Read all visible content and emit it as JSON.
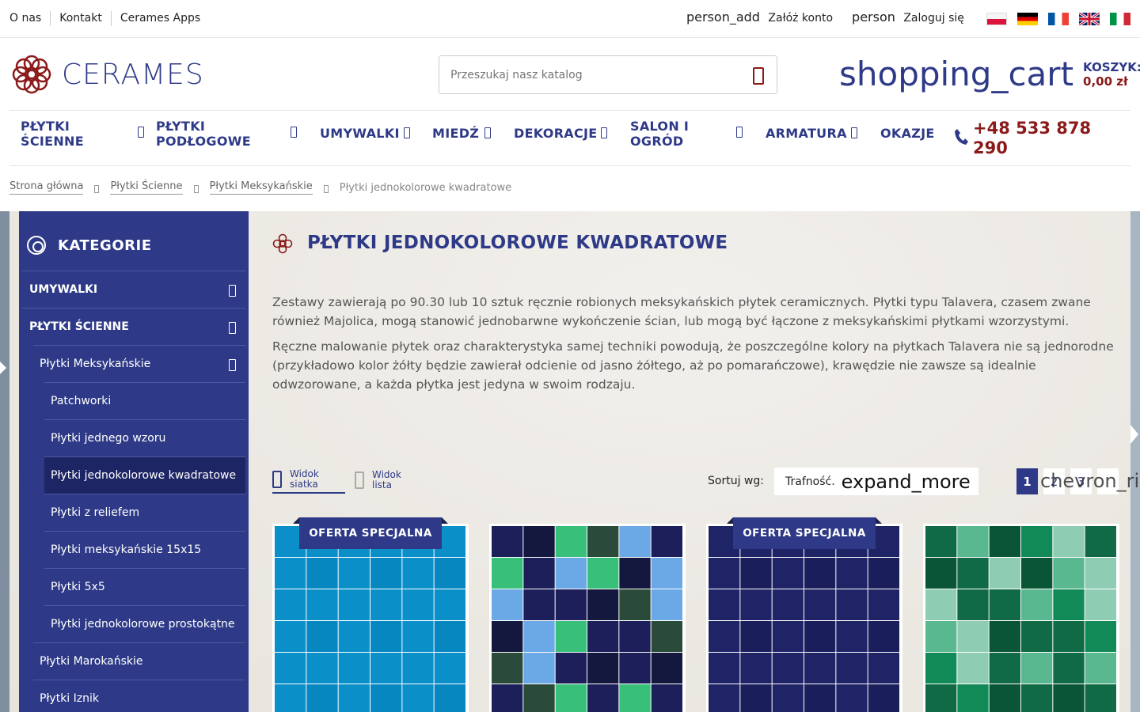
{
  "top_links": [
    "O nas",
    "Kontakt",
    "Cerames Apps"
  ],
  "account": {
    "register_icon": "person_add",
    "register_label": "Załóż konto",
    "login_icon": "person",
    "login_label": "Zaloguj się"
  },
  "languages": [
    "pl",
    "de",
    "fr",
    "en",
    "it"
  ],
  "logo_text": "CERAMES",
  "search": {
    "placeholder": "Przeszukaj nasz katalog"
  },
  "cart": {
    "icon": "shopping_cart",
    "label": "KOSZYK:",
    "total": "0,00 zł"
  },
  "nav": [
    {
      "label": "PŁYTKI ŚCIENNE",
      "dropdown": true
    },
    {
      "label": "PŁYTKI PODŁOGOWE",
      "dropdown": true
    },
    {
      "label": "UMYWALKI",
      "dropdown": true
    },
    {
      "label": "MIEDŹ",
      "dropdown": true
    },
    {
      "label": "DEKORACJE",
      "dropdown": true
    },
    {
      "label": "SALON I OGRÓD",
      "dropdown": true
    },
    {
      "label": "ARMATURA",
      "dropdown": true
    },
    {
      "label": "OKAZJE",
      "dropdown": false
    }
  ],
  "phone": "+48 533 878 290",
  "breadcrumb": [
    "Strona główna",
    "Płytki Ścienne",
    "Płytki Meksykańskie"
  ],
  "breadcrumb_current": "Płytki jednokolorowe kwadratowe",
  "sidebar": {
    "title": "KATEGORIE",
    "items": [
      {
        "label": "UMYWALKI",
        "level": 0,
        "expandable": true
      },
      {
        "label": "PŁYTKI ŚCIENNE",
        "level": 0,
        "expandable": true
      },
      {
        "label": "Płytki Meksykańskie",
        "level": 1,
        "expandable": true
      },
      {
        "label": "Patchworki",
        "level": 2
      },
      {
        "label": "Płytki jednego wzoru",
        "level": 2
      },
      {
        "label": "Płytki jednokolorowe kwadratowe",
        "level": 2,
        "active": true
      },
      {
        "label": "Płytki z reliefem",
        "level": 2
      },
      {
        "label": "Płytki meksykańskie 15x15",
        "level": 2
      },
      {
        "label": "Płytki 5x5",
        "level": 2
      },
      {
        "label": "Płytki jednokolorowe prostokątne",
        "level": 2
      },
      {
        "label": "Płytki Marokańskie",
        "level": 1
      },
      {
        "label": "Płytki Iznik",
        "level": 1
      }
    ]
  },
  "category": {
    "title": "PŁYTKI JEDNOKOLOROWE KWADRATOWE",
    "description": [
      "Zestawy zawierają po 90.30 lub 10 sztuk ręcznie robionych meksykańskich płytek ceramicznych. Płytki typu Talavera, czasem zwane również Majolica, mogą stanowić jednobarwne wykończenie ścian, lub mogą być łączone z meksykańskimi płytkami wzorzystymi.",
      "Ręczne malowanie płytek oraz charakterystyka samej techniki powodują, że poszczególne kolory na płytkach Talavera nie są jednorodne (przykładowo kolor żółty będzie zawierał odcienie od jasno żółtego, aż po pomarańczowe), krawędzie nie zawsze są idealnie odwzorowane, a każda płytka jest jedyna w swoim rodzaju."
    ]
  },
  "views": {
    "grid": "Widok siatka",
    "list": "Widok lista"
  },
  "sort": {
    "label": "Sortuj wg:",
    "value": "Trafność.",
    "icon": "expand_more"
  },
  "pagination": {
    "pages": [
      "1",
      "2",
      "3"
    ],
    "active": "1",
    "next_icon": "chevron_right"
  },
  "products": [
    {
      "badge": "OFERTA SPECJALNA",
      "colors": [
        "#0a8fc9",
        "#0b9fd8",
        "#0687bf",
        "#12a6df"
      ]
    },
    {
      "badge": "",
      "colors": [
        "#1c1f5a",
        "#6aa8e6",
        "#2a4a3a",
        "#38c07a",
        "#14183f"
      ]
    },
    {
      "badge": "OFERTA SPECJALNA",
      "colors": [
        "#1e2466",
        "#252c78",
        "#1a1f5c",
        "#2a3080"
      ]
    },
    {
      "badge": "",
      "colors": [
        "#0f6a45",
        "#8ecdb4",
        "#118a58",
        "#0a5535",
        "#5ab890"
      ]
    }
  ],
  "colors": {
    "brand_blue": "#2e3a87",
    "brand_red": "#8b1a1a"
  }
}
